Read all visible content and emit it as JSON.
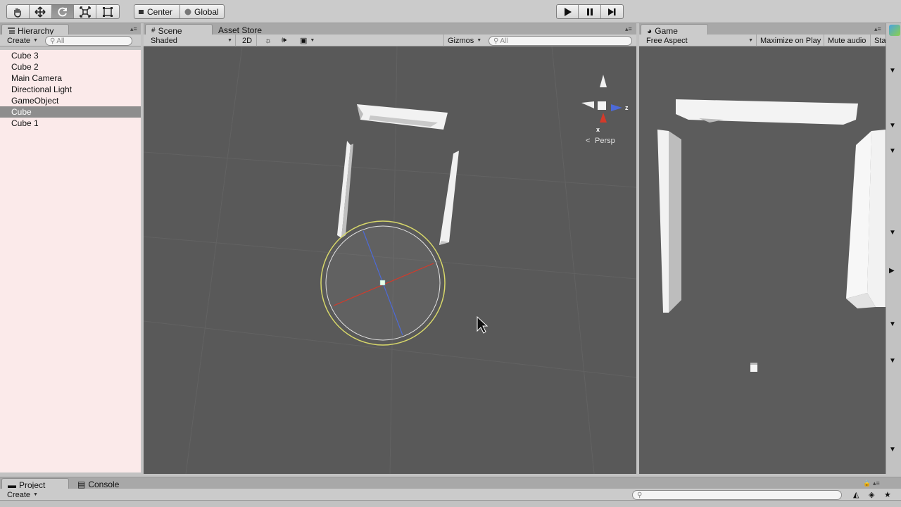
{
  "toolbar": {
    "tools": [
      {
        "name": "hand-tool",
        "icon": "hand-icon",
        "active": false
      },
      {
        "name": "move-tool",
        "icon": "move-icon",
        "active": false
      },
      {
        "name": "rotate-tool",
        "icon": "rotate-icon",
        "active": true
      },
      {
        "name": "scale-tool",
        "icon": "scale-icon",
        "active": false
      },
      {
        "name": "rect-tool",
        "icon": "rect-icon",
        "active": false
      }
    ],
    "pivot_label": "Center",
    "space_label": "Global",
    "play_controls": [
      "play-icon",
      "pause-icon",
      "step-icon"
    ]
  },
  "hierarchy": {
    "tab_label": "Hierarchy",
    "create_label": "Create",
    "search_placeholder": "All",
    "items": [
      "Cube 3",
      "Cube 2",
      "Main Camera",
      "Directional Light",
      "GameObject",
      "Cube",
      "Cube 1"
    ],
    "selected_index": 5
  },
  "scene": {
    "tab_label": "Scene",
    "store_tab_label": "Asset Store",
    "shading_label": "Shaded",
    "mode_2d_label": "2D",
    "gizmos_label": "Gizmos",
    "search_placeholder": "All",
    "gizmo_z_label": "z",
    "gizmo_x_label": "x",
    "persp_label": "Persp"
  },
  "game": {
    "tab_label": "Game",
    "aspect_label": "Free Aspect",
    "maximize_label": "Maximize on Play",
    "mute_label": "Mute audio",
    "stats_label": "Sta"
  },
  "project": {
    "tab_label": "Project",
    "console_tab_label": "Console",
    "create_label": "Create"
  },
  "colors": {
    "selection": "#8e8e8e",
    "hierarchy_bg": "#fbeaea",
    "scene_bg": "#595959",
    "game_bg": "#5c5c5c",
    "rotate_yellow": "#d8d86a",
    "axis_red": "#d43a2a",
    "axis_blue": "#4d6ad8"
  }
}
